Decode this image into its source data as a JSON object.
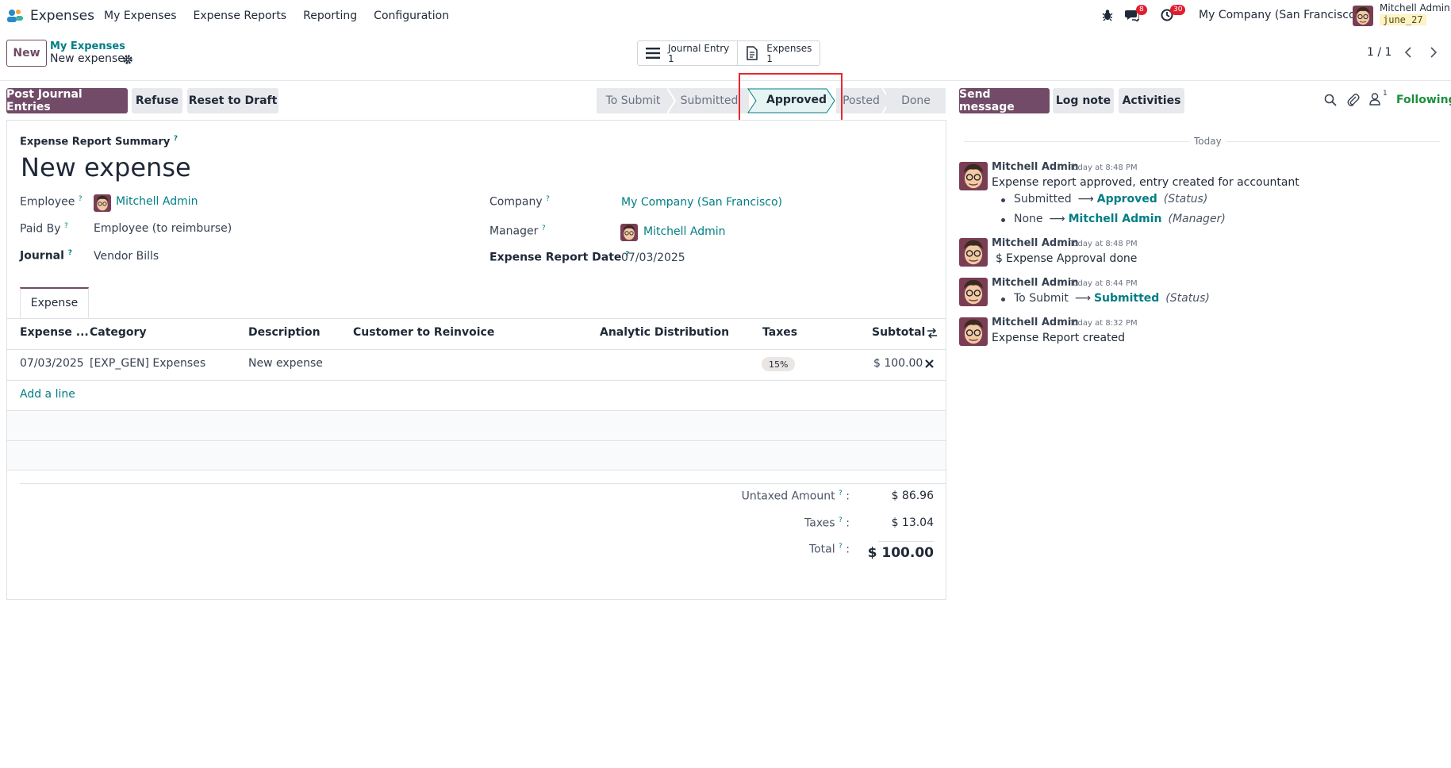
{
  "navbar": {
    "app_name": "Expenses",
    "menu": [
      "My Expenses",
      "Expense Reports",
      "Reporting",
      "Configuration"
    ],
    "chat_badge": "8",
    "activity_badge": "30",
    "company": "My Company (San Francisco)",
    "user": "Mitchell Admin",
    "db": "june_27"
  },
  "control_panel": {
    "new_label": "New",
    "breadcrumb_parent": "My Expenses",
    "breadcrumb_current": "New expense",
    "smart_buttons": [
      {
        "label": "Journal Entry",
        "count": "1",
        "icon": "list-icon"
      },
      {
        "label": "Expenses",
        "count": "1",
        "icon": "document-icon"
      }
    ],
    "pager": "1 / 1"
  },
  "actions": {
    "post": "Post Journal Entries",
    "refuse": "Refuse",
    "reset": "Reset to Draft"
  },
  "statusbar": {
    "stages": [
      "To Submit",
      "Submitted",
      "Approved",
      "Posted",
      "Done"
    ],
    "current": "Approved"
  },
  "form": {
    "summary_label": "Expense Report Summary",
    "title": "New expense",
    "employee_label": "Employee",
    "employee": "Mitchell Admin",
    "paid_by_label": "Paid By",
    "paid_by": "Employee (to reimburse)",
    "journal_label": "Journal",
    "journal": "Vendor Bills",
    "company_label": "Company",
    "company": "My Company (San Francisco)",
    "manager_label": "Manager",
    "manager": "Mitchell Admin",
    "date_label": "Expense Report Date",
    "date": "07/03/2025",
    "tab": "Expense",
    "columns": [
      "Expense ...",
      "Category",
      "Description",
      "Customer to Reinvoice",
      "Analytic Distribution",
      "Taxes",
      "Subtotal"
    ],
    "rows": [
      {
        "date": "07/03/2025",
        "category": "[EXP_GEN] Expenses",
        "description": "New expense",
        "tax": "15%",
        "subtotal": "$ 100.00"
      }
    ],
    "add_line": "Add a line",
    "untaxed_label": "Untaxed Amount",
    "untaxed": "$ 86.96",
    "taxes_label": "Taxes",
    "taxes": "$ 13.04",
    "total_label": "Total",
    "total": "$ 100.00"
  },
  "chatter": {
    "send_message": "Send message",
    "log_note": "Log note",
    "activities": "Activities",
    "followers_count": "1",
    "following": "Following",
    "today": "Today",
    "messages": [
      {
        "author": "Mitchell Admin",
        "time": "Today at 8:48 PM",
        "body": "Expense report approved, entry created for accountant",
        "tracking": [
          {
            "old": "Submitted",
            "new": "Approved",
            "field": "(Status)"
          },
          {
            "old": "None",
            "new": "Mitchell Admin",
            "field": "(Manager)"
          }
        ]
      },
      {
        "author": "Mitchell Admin",
        "time": "Today at 8:48 PM",
        "body": "Expense Approval done"
      },
      {
        "author": "Mitchell Admin",
        "time": "Today at 8:44 PM",
        "tracking": [
          {
            "old": "To Submit",
            "new": "Submitted",
            "field": "(Status)"
          }
        ]
      },
      {
        "author": "Mitchell Admin",
        "time": "Today at 8:32 PM",
        "body": "Expense Report created"
      }
    ]
  },
  "colors": {
    "brand": "#714b67",
    "link": "#017e84",
    "highlight": "#e8262b",
    "following": "#1e8e3e"
  }
}
